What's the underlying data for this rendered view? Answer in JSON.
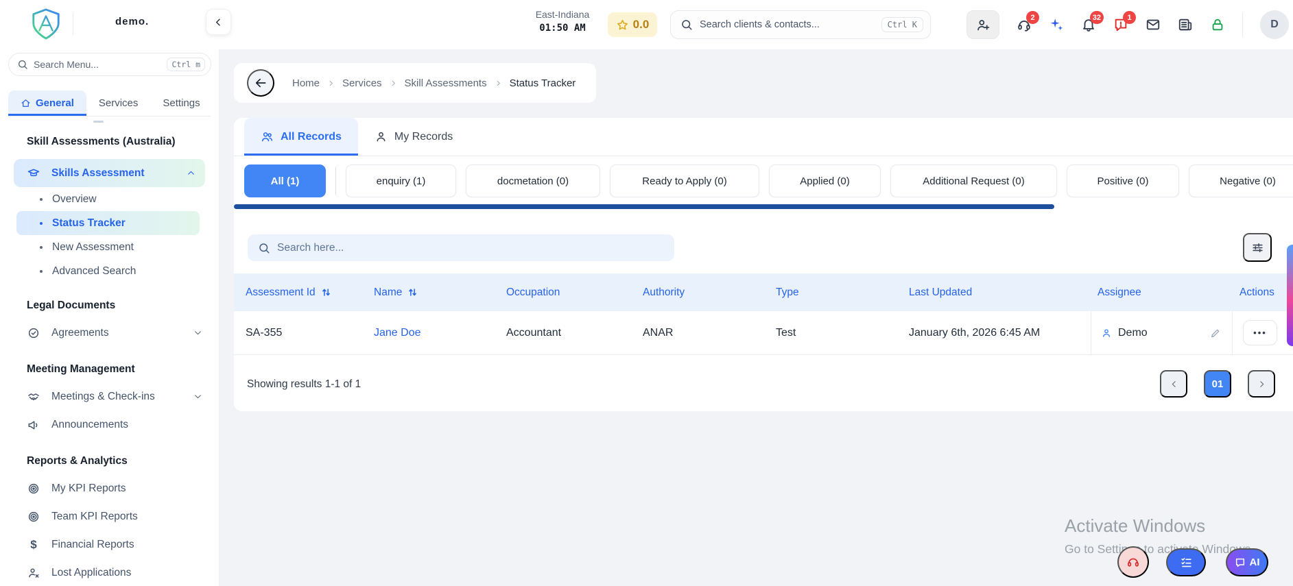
{
  "colors": {
    "accent": "#4285f4",
    "link_blue": "#2563eb",
    "scrollbar_blue": "#1d4f9e",
    "badge_red": "#ef4444",
    "lock_green": "#16a34a",
    "rating_amber": "#b97f12",
    "table_header_bg": "#e9f1fd",
    "active_gradient": "linear(#dbeafe,#e3f6ec)"
  },
  "icons": {
    "dollar": "$",
    "ellipsis": "•••"
  },
  "header": {
    "brand": "demo.",
    "timezone": "East-Indiana",
    "time": "01:50 AM",
    "rating": "0.0",
    "search": {
      "placeholder": "Search clients & contacts...",
      "shortcut": "Ctrl K"
    },
    "badges": {
      "support": "2",
      "notifications": "32",
      "messages": "1"
    },
    "avatar": "D"
  },
  "sidebar": {
    "search": {
      "placeholder": "Search Menu...",
      "shortcut": "Ctrl m"
    },
    "tabs": [
      {
        "label": "General"
      },
      {
        "label": "Services"
      },
      {
        "label": "Settings"
      }
    ],
    "sections": [
      {
        "heading": "Skill Assessments (Australia)",
        "items": [
          {
            "label": "Skills Assessment",
            "children": [
              {
                "label": "Overview"
              },
              {
                "label": "Status Tracker"
              },
              {
                "label": "New Assessment"
              },
              {
                "label": "Advanced Search"
              }
            ]
          }
        ]
      },
      {
        "heading": "Legal Documents",
        "items": [
          {
            "label": "Agreements"
          }
        ]
      },
      {
        "heading": "Meeting Management",
        "items": [
          {
            "label": "Meetings & Check-ins"
          },
          {
            "label": "Announcements"
          }
        ]
      },
      {
        "heading": "Reports & Analytics",
        "items": [
          {
            "label": "My KPI Reports"
          },
          {
            "label": "Team KPI Reports"
          },
          {
            "label": "Financial Reports"
          },
          {
            "label": "Lost Applications"
          }
        ]
      }
    ]
  },
  "breadcrumb": {
    "items": [
      {
        "label": "Home"
      },
      {
        "label": "Services"
      },
      {
        "label": "Skill Assessments"
      },
      {
        "label": "Status Tracker"
      }
    ]
  },
  "main": {
    "tabs": [
      {
        "label": "All Records"
      },
      {
        "label": "My Records"
      }
    ],
    "filters": [
      {
        "label": "All (1)"
      },
      {
        "label": "enquiry (1)"
      },
      {
        "label": "docmetation (0)"
      },
      {
        "label": "Ready to Apply (0)"
      },
      {
        "label": "Applied (0)"
      },
      {
        "label": "Additional Request (0)"
      },
      {
        "label": "Positive (0)"
      },
      {
        "label": "Negative (0)"
      }
    ],
    "search": {
      "placeholder": "Search here..."
    },
    "table": {
      "columns": [
        {
          "label": "Assessment Id"
        },
        {
          "label": "Name"
        },
        {
          "label": "Occupation"
        },
        {
          "label": "Authority"
        },
        {
          "label": "Type"
        },
        {
          "label": "Last Updated"
        },
        {
          "label": "Assignee"
        },
        {
          "label": "Actions"
        }
      ],
      "rows": [
        {
          "assessment_id": "SA-355",
          "name": "Jane Doe",
          "occupation": "Accountant",
          "authority": "ANAR",
          "type": "Test",
          "last_updated": "January 6th, 2026 6:45 AM",
          "assignee": "Demo"
        }
      ]
    },
    "results_text": "Showing results 1-1 of 1",
    "pagination": {
      "current_page": "01"
    }
  },
  "watermark": {
    "line1": "Activate Windows",
    "line2": "Go to Settings to activate Windows"
  },
  "floating": {
    "ai_label": "AI"
  }
}
